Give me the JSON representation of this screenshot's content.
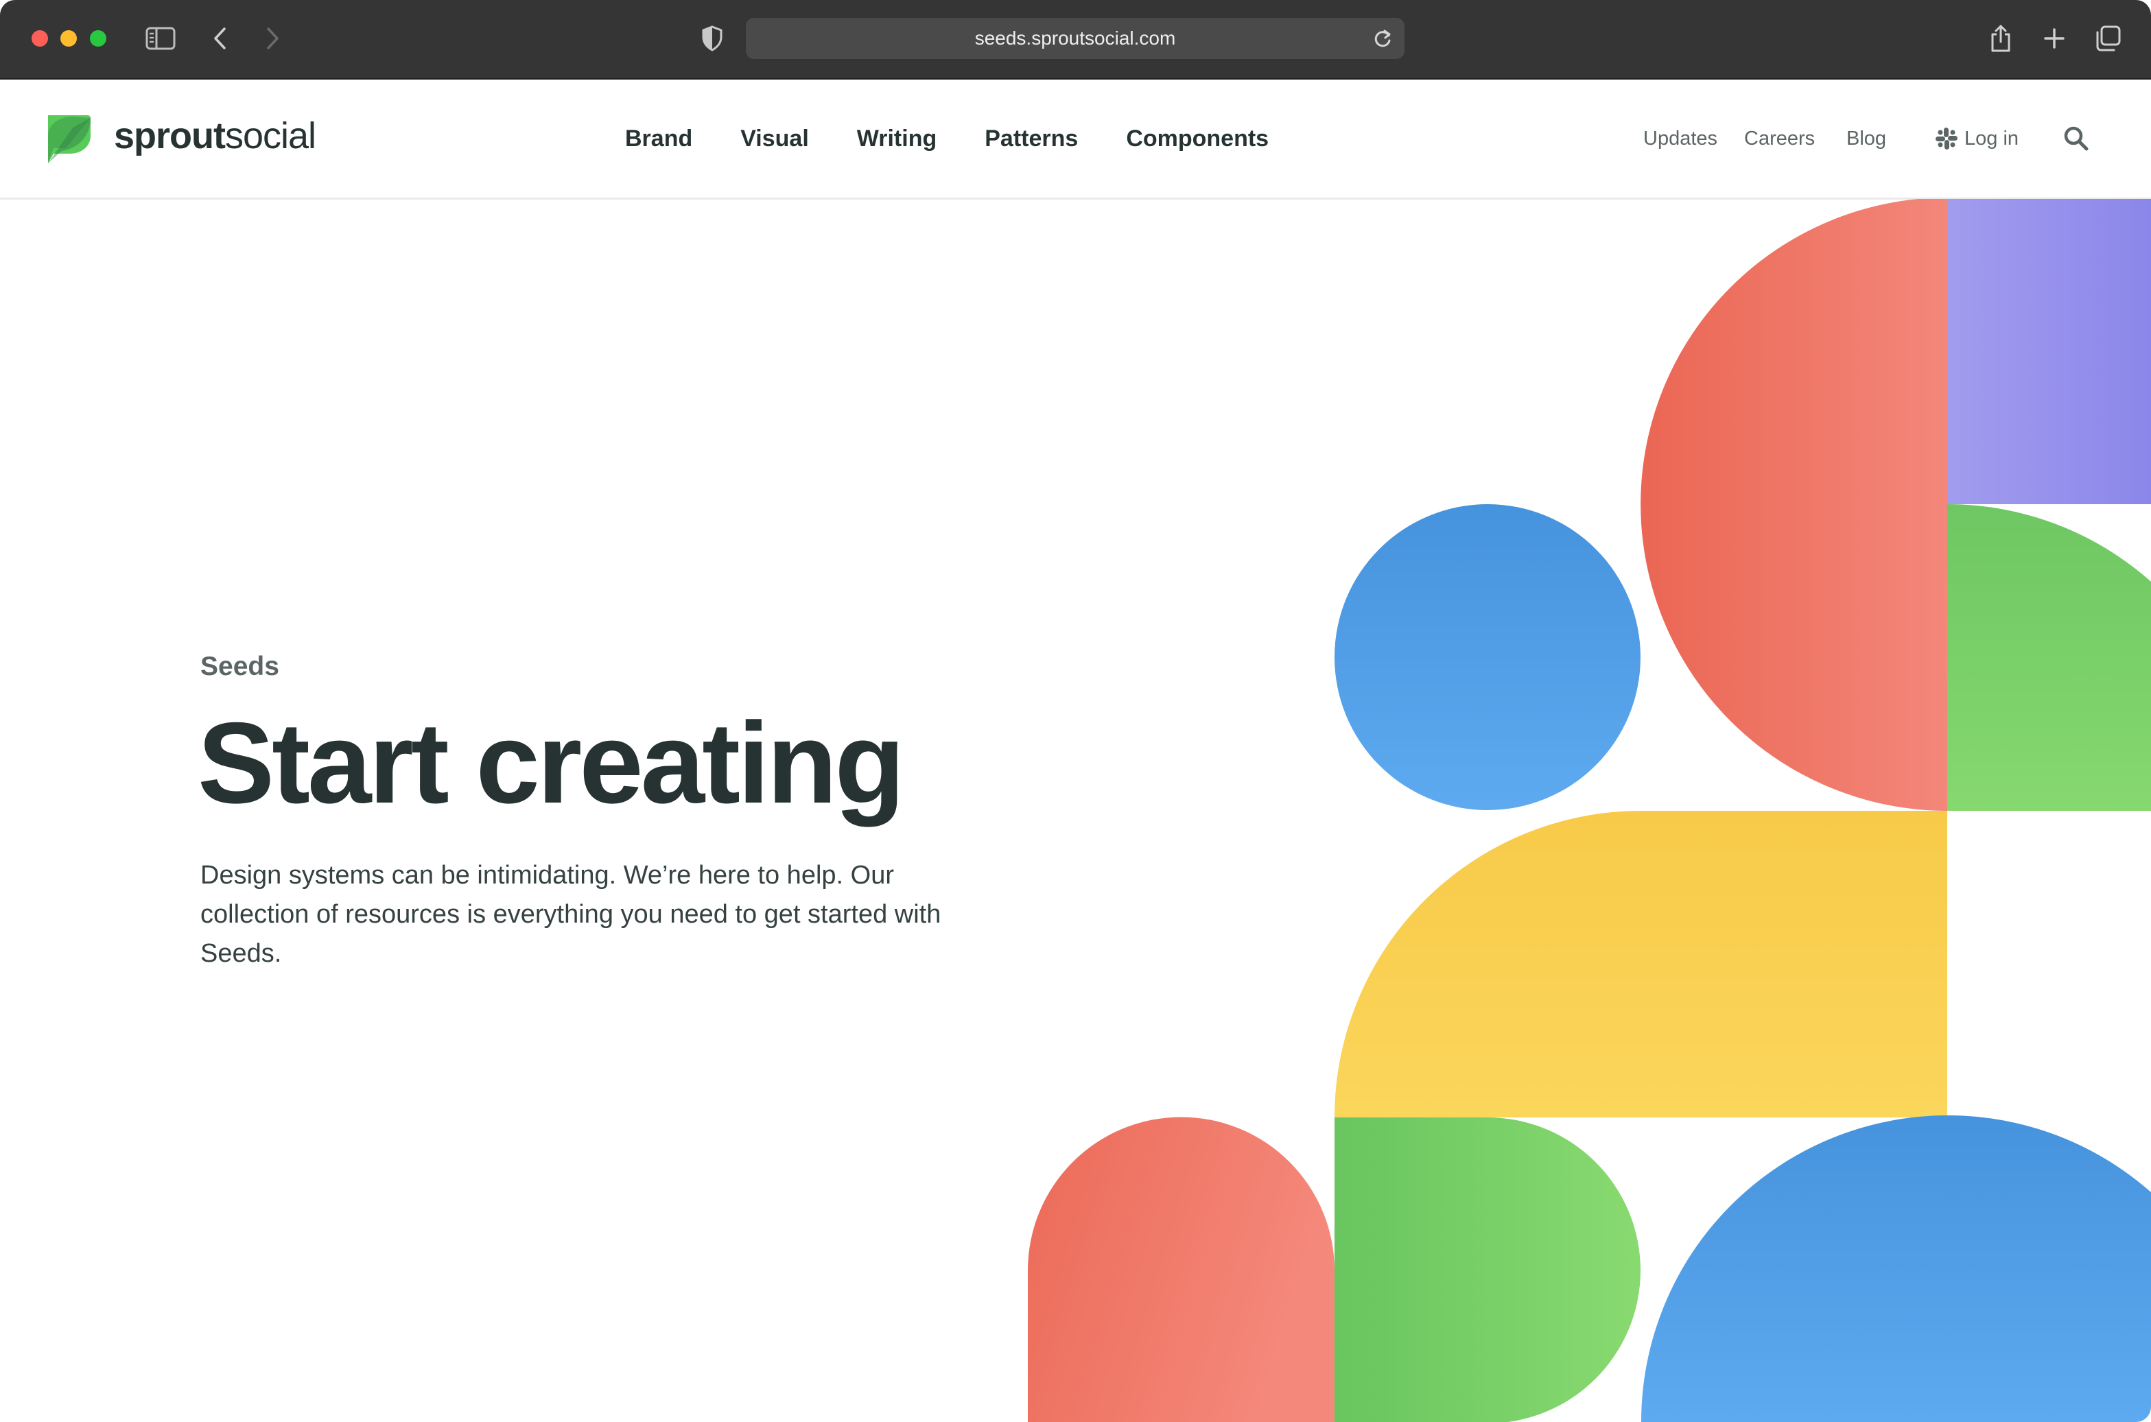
{
  "browser": {
    "url": "seeds.sproutsocial.com"
  },
  "header": {
    "logo_bold": "sprout",
    "logo_light": "social",
    "nav": [
      "Brand",
      "Visual",
      "Writing",
      "Patterns",
      "Components"
    ],
    "util": {
      "updates": "Updates",
      "careers": "Careers",
      "blog": "Blog",
      "login": "Log in"
    }
  },
  "hero": {
    "eyebrow": "Seeds",
    "title": "Start creating",
    "description": "Design systems can be intimidating. We’re here to help. Our collection of resources is everything you need to get started with Seeds."
  },
  "colors": {
    "red": "#ee6b59",
    "purple": "#9590ec",
    "green": "#6dc862",
    "blue": "#4b97e0",
    "yellow": "#f9cc4c",
    "text_dark": "#273333"
  }
}
